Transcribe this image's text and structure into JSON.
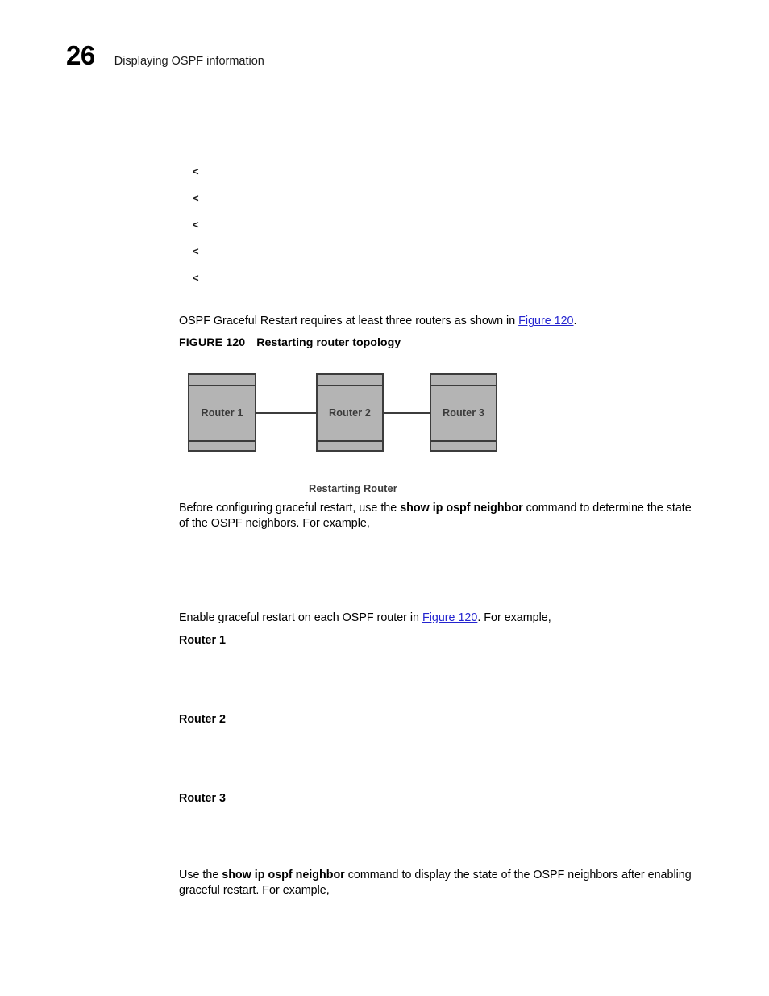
{
  "header": {
    "page_number": "26",
    "title": "Displaying OSPF information"
  },
  "markers": [
    {
      "glyph": "<"
    },
    {
      "glyph": "<"
    },
    {
      "glyph": "<"
    },
    {
      "glyph": "<"
    },
    {
      "glyph": "<"
    }
  ],
  "paragraphs": {
    "intro": {
      "before_link": "OSPF Graceful Restart requires at least three routers as shown in ",
      "link": "Figure 120",
      "after_link": "."
    },
    "before_configuring": {
      "part1": "Before configuring graceful restart, use the ",
      "command": "show ip ospf neighbor",
      "part2": " command to determine the state of the OSPF neighbors. For example,"
    },
    "enable_restart": {
      "before_link": "Enable graceful restart on each OSPF router in ",
      "link": "Figure 120",
      "after_link": ". For example,"
    },
    "use_command": {
      "part1": "Use the ",
      "command": "show ip ospf neighbor",
      "part2": " command to display the state of the OSPF neighbors after enabling graceful restart. For example,"
    }
  },
  "figure": {
    "caption_label": "FIGURE 120",
    "caption_title": "Restarting router topology",
    "restarting_router_label": "Restarting Router",
    "routers": [
      {
        "label": "Router 1"
      },
      {
        "label": "Router 2"
      },
      {
        "label": "Router 3"
      }
    ]
  },
  "router_sections": [
    {
      "heading": "Router 1"
    },
    {
      "heading": "Router 2"
    },
    {
      "heading": "Router 3"
    }
  ],
  "colors": {
    "link": "#2424cf",
    "router_fill": "#b4b4b4",
    "router_border": "#3c3c3c",
    "caption_text": "#3a3a3a"
  }
}
